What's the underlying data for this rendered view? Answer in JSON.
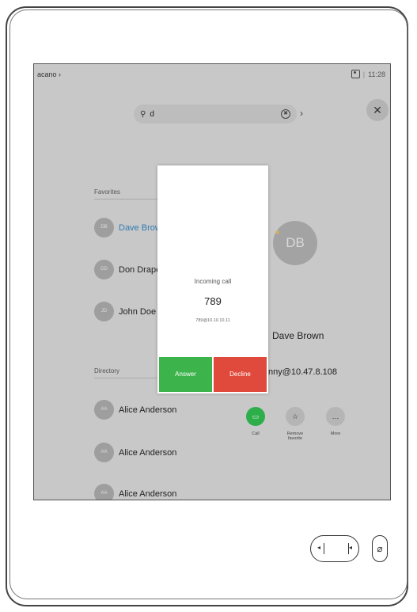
{
  "topbar": {
    "left_text": "acano ›",
    "time": "11:28"
  },
  "search": {
    "value": "d",
    "search_icon": "⚲",
    "clear_icon": "✖"
  },
  "sections": {
    "favorites": "Favorites",
    "directory": "Directory"
  },
  "favorites": [
    {
      "initials": "DB",
      "name": "Dave Brown",
      "selected": true
    },
    {
      "initials": "DD",
      "name": "Don Draper",
      "selected": false
    },
    {
      "initials": "JD",
      "name": "John Doe",
      "selected": false
    }
  ],
  "directory": [
    {
      "initials": "AA",
      "name": "Alice Anderson"
    },
    {
      "initials": "AA",
      "name": "Alice Anderson"
    },
    {
      "initials": "AA",
      "name": "Alice Anderson"
    }
  ],
  "contact": {
    "initials": "DB",
    "name": "Dave Brown",
    "uri": "nny@10.47.8.108"
  },
  "actions": {
    "call": "Call",
    "remove_favorite": "Remove favorite",
    "more": "More"
  },
  "dialog": {
    "title": "Incoming call",
    "number": "789",
    "uri": "789@10.10.10.11",
    "answer_label": "Answer",
    "decline_label": "Decline"
  },
  "colors": {
    "answer": "#3cb44b",
    "decline": "#e04a3c",
    "link": "#2f7cb5",
    "call": "#2eae4a"
  }
}
